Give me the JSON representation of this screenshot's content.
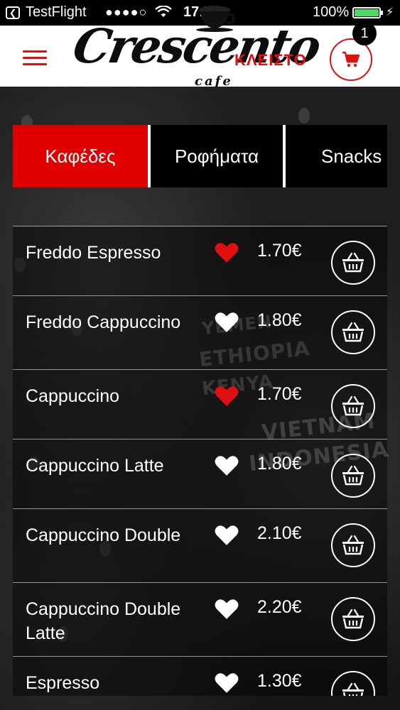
{
  "status_bar": {
    "carrier": "TestFlight",
    "signal": "●●●●○",
    "time": "17:50",
    "battery_pct": "100%"
  },
  "header": {
    "logo_text": "Crescento",
    "logo_sub": "cafe",
    "closed_label": "ΚΛΕΙΣΤΟ",
    "cart_count": "1"
  },
  "tabs": [
    {
      "label": "Καφέδες",
      "active": true
    },
    {
      "label": "Ροφήματα",
      "active": false
    },
    {
      "label": "Snacks",
      "active": false
    }
  ],
  "items": [
    {
      "name": "Freddo Espresso",
      "price": "1.70€",
      "favorite": true
    },
    {
      "name": "Freddo Cappuccino",
      "price": "1.80€",
      "favorite": false
    },
    {
      "name": "Cappuccino",
      "price": "1.70€",
      "favorite": true
    },
    {
      "name": "Cappuccino Latte",
      "price": "1.80€",
      "favorite": false
    },
    {
      "name": "Cappuccino Double",
      "price": "2.10€",
      "favorite": false
    },
    {
      "name": "Cappuccino Double Latte",
      "price": "2.20€",
      "favorite": false
    },
    {
      "name": "Espresso",
      "price": "1.30€",
      "favorite": false
    }
  ],
  "background_words": [
    "YEMEN",
    "ETHIOPIA",
    "KENYA",
    "VIETNAM",
    "INDONESIA"
  ],
  "colors": {
    "accent_red": "#e00000",
    "favorite_red": "#e01010",
    "battery_green": "#4cd964"
  }
}
